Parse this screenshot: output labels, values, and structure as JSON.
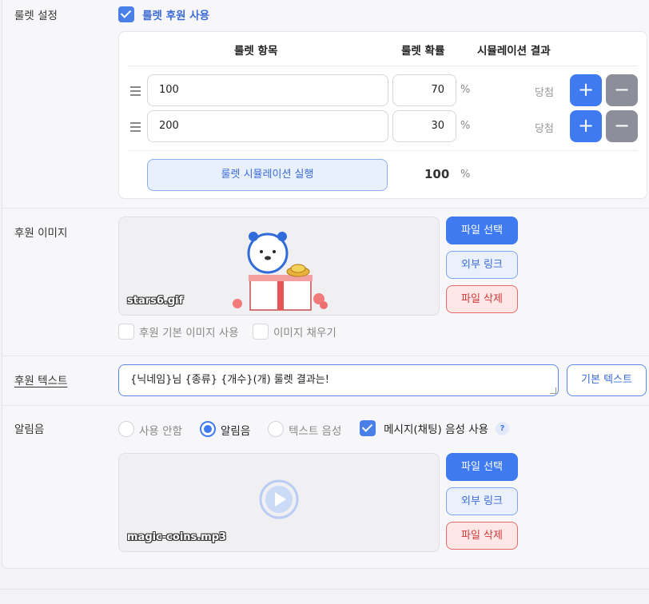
{
  "roulette": {
    "label": "룰렛 설정",
    "enable_label": "룰렛 후원 사용",
    "enabled": true,
    "headers": {
      "item": "룰렛 항목",
      "prob": "룰렛 확률",
      "result": "시뮬레이션 결과"
    },
    "rows": [
      {
        "item": "100",
        "prob": "70",
        "unit": "%",
        "result": "당첨"
      },
      {
        "item": "200",
        "prob": "30",
        "unit": "%",
        "result": "당첨"
      }
    ],
    "plus": "+",
    "minus": "−",
    "simulate_button": "룰렛 시뮬레이션 실행",
    "total": "100",
    "total_unit": "%"
  },
  "image": {
    "label": "후원 이미지",
    "filename": "stars6.gif",
    "select_button": "파일 선택",
    "link_button": "외부 링크",
    "delete_button": "파일 삭제",
    "options": [
      {
        "label": "후원 기본 이미지 사용",
        "checked": false
      },
      {
        "label": "이미지 채우기",
        "checked": false
      }
    ]
  },
  "text": {
    "label": "후원 텍스트",
    "value": "{닉네임}님 {종류} {개수}(개) 룰렛 결과는!",
    "default_button": "기본 텍스트"
  },
  "sound": {
    "label": "알림음",
    "radios": [
      {
        "label": "사용 안함",
        "selected": false
      },
      {
        "label": "알림음",
        "selected": true
      },
      {
        "label": "텍스트 음성",
        "selected": false
      }
    ],
    "tts_label": "메시지(채팅) 음성 사용",
    "tts_checked": true,
    "help": "?",
    "filename": "magic-coins.mp3",
    "select_button": "파일 선택",
    "link_button": "외부 링크",
    "delete_button": "파일 삭제"
  },
  "colors": {
    "accent": "#3f7af0",
    "danger": "#d23a3a",
    "muted": "#8c8e99"
  }
}
